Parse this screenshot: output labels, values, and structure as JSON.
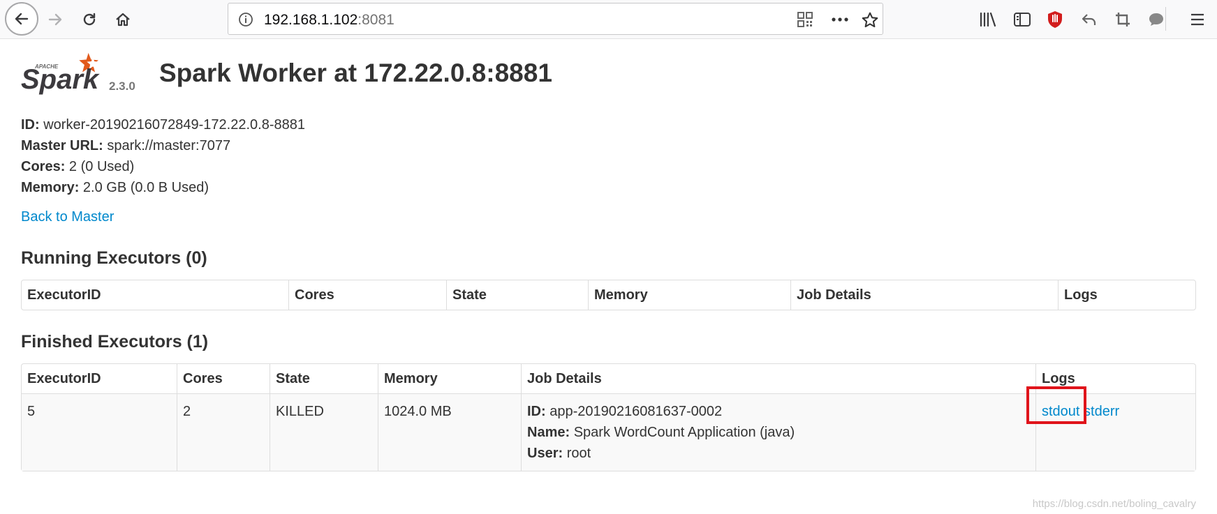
{
  "browser": {
    "url_host": "192.168.1.102",
    "url_port": ":8081"
  },
  "header": {
    "logo_text": "Spark",
    "logo_apache": "APACHE",
    "version": "2.3.0",
    "title": "Spark Worker at 172.22.0.8:8881"
  },
  "worker": {
    "id_label": "ID:",
    "id_value": "worker-20190216072849-172.22.0.8-8881",
    "master_label": "Master URL:",
    "master_value": "spark://master:7077",
    "cores_label": "Cores:",
    "cores_value": "2 (0 Used)",
    "memory_label": "Memory:",
    "memory_value": "2.0 GB (0.0 B Used)",
    "back_link": "Back to Master"
  },
  "running": {
    "heading": "Running Executors (0)",
    "columns": [
      "ExecutorID",
      "Cores",
      "State",
      "Memory",
      "Job Details",
      "Logs"
    ]
  },
  "finished": {
    "heading": "Finished Executors (1)",
    "columns": [
      "ExecutorID",
      "Cores",
      "State",
      "Memory",
      "Job Details",
      "Logs"
    ],
    "rows": [
      {
        "executor_id": "5",
        "cores": "2",
        "state": "KILLED",
        "memory": "1024.0 MB",
        "job_id_label": "ID:",
        "job_id": "app-20190216081637-0002",
        "job_name_label": "Name:",
        "job_name": "Spark WordCount Application (java)",
        "job_user_label": "User:",
        "job_user": "root",
        "log_stdout": "stdout",
        "log_stderr": "stderr"
      }
    ]
  },
  "watermark": "https://blog.csdn.net/boling_cavalry",
  "colors": {
    "link": "#0088cc",
    "highlight": "#e0141b",
    "row_bg": "#f9f9f9"
  }
}
